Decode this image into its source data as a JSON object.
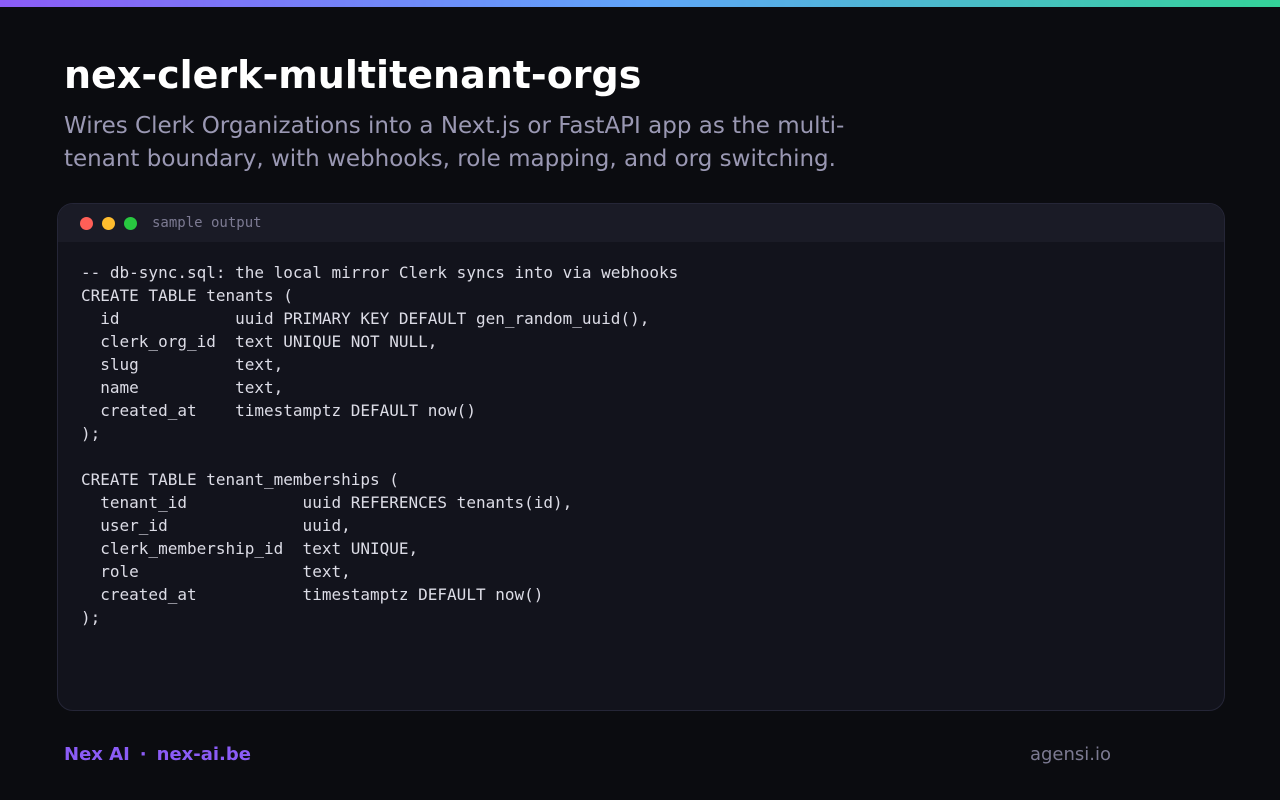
{
  "header": {
    "title": "nex-clerk-multitenant-orgs",
    "subtitle": "Wires Clerk Organizations into a Next.js or FastAPI app as the multi-tenant boundary, with webhooks, role mapping, and org switching."
  },
  "terminal": {
    "title": "sample output",
    "lines": [
      "-- db-sync.sql: the local mirror Clerk syncs into via webhooks",
      "CREATE TABLE tenants (",
      "  id            uuid PRIMARY KEY DEFAULT gen_random_uuid(),",
      "  clerk_org_id  text UNIQUE NOT NULL,",
      "  slug          text,",
      "  name          text,",
      "  created_at    timestamptz DEFAULT now()",
      ");",
      "",
      "CREATE TABLE tenant_memberships (",
      "  tenant_id            uuid REFERENCES tenants(id),",
      "  user_id              uuid,",
      "  clerk_membership_id  text UNIQUE,",
      "  role                 text,",
      "  created_at           timestamptz DEFAULT now()",
      ");"
    ]
  },
  "footer": {
    "brand": "Nex AI",
    "separator": "·",
    "site": "nex-ai.be",
    "credit": "agensi.io"
  },
  "colors": {
    "background": "#0b0c10",
    "accent": "#8b5cf6",
    "gradient_start": "#8b5cf6",
    "gradient_end": "#34d399"
  }
}
